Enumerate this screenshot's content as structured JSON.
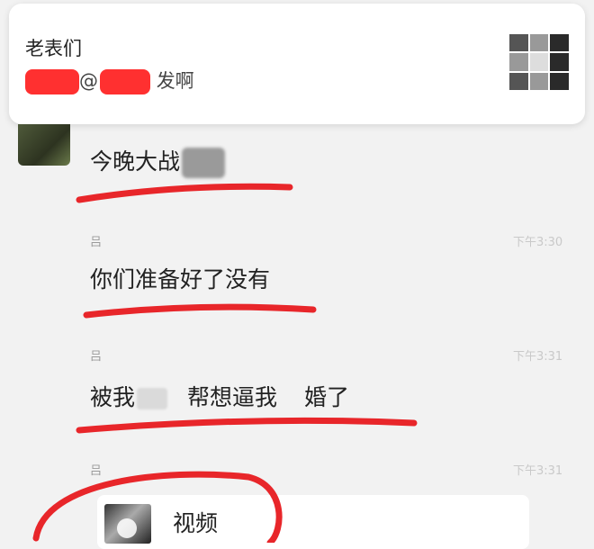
{
  "notification": {
    "group_name": "老表们",
    "mention_prefix": "@",
    "message_tail": "发啊",
    "group_avatar_icon": "group-avatar-grid"
  },
  "chat": {
    "messages": [
      {
        "sender": "",
        "text": "今晚大战",
        "timestamp": ""
      },
      {
        "sender": "吕",
        "text": "你们准备好了没有",
        "timestamp": "下午3:30"
      },
      {
        "sender": "吕",
        "text_parts": [
          "被我",
          "帮想逼我",
          "婚了"
        ],
        "timestamp": "下午3:31"
      },
      {
        "sender": "吕",
        "text": "视频",
        "timestamp": "下午3:31",
        "attachment_icon": "video-thumbnail-icon"
      }
    ]
  },
  "colors": {
    "annotation_red": "#e8262a",
    "background": "#f2f2f2"
  }
}
